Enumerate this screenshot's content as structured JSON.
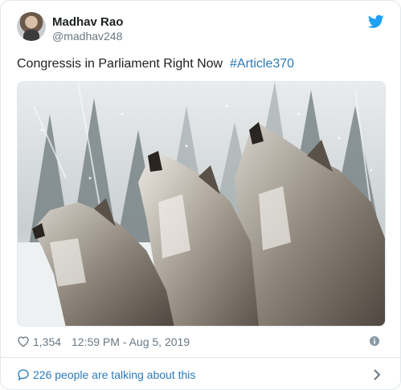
{
  "author": {
    "name": "Madhav Rao",
    "handle": "@madhav248",
    "avatar_icon": "user-avatar"
  },
  "brand": {
    "icon": "twitter-bird-icon",
    "color": "#1da1f2"
  },
  "tweet": {
    "text": "Congressis in Parliament Right Now",
    "hashtag": "#Article370",
    "hashtag_color": "#2b7bb9"
  },
  "media": {
    "icon": "photo-three-wolves-howling-in-snowy-forest"
  },
  "footer": {
    "like_icon": "heart-icon",
    "likes": "1,354",
    "timestamp": "12:59 PM - Aug 5, 2019",
    "info_icon": "info-icon"
  },
  "conversation": {
    "icon": "speech-bubble-icon",
    "label": "226 people are talking about this",
    "chevron_icon": "chevron-right-icon",
    "link_color": "#2b7bb9"
  }
}
